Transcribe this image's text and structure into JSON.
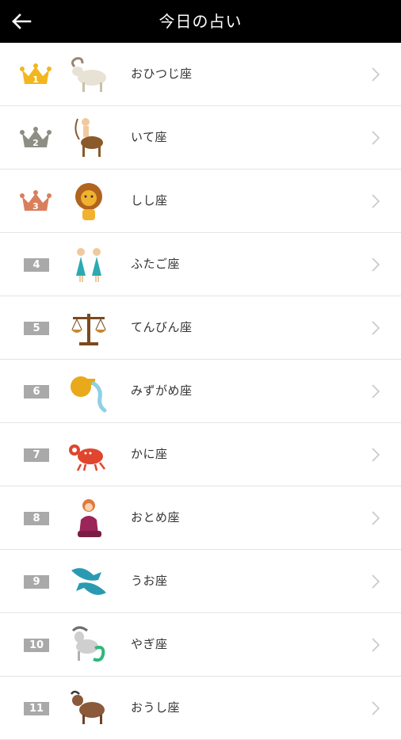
{
  "header": {
    "title": "今日の占い",
    "back_icon": "back-arrow-icon"
  },
  "colors": {
    "gold": "#F2B71E",
    "silver": "#8E8E85",
    "bronze": "#D97F5D",
    "badge": "#A9A9A9"
  },
  "rankings": [
    {
      "rank": "1",
      "sign": "おひつじ座",
      "icon": "aries-ram-icon"
    },
    {
      "rank": "2",
      "sign": "いて座",
      "icon": "sagittarius-centaur-icon"
    },
    {
      "rank": "3",
      "sign": "しし座",
      "icon": "leo-lion-icon"
    },
    {
      "rank": "4",
      "sign": "ふたご座",
      "icon": "gemini-twins-icon"
    },
    {
      "rank": "5",
      "sign": "てんびん座",
      "icon": "libra-scales-icon"
    },
    {
      "rank": "6",
      "sign": "みずがめ座",
      "icon": "aquarius-pot-icon"
    },
    {
      "rank": "7",
      "sign": "かに座",
      "icon": "cancer-crab-icon"
    },
    {
      "rank": "8",
      "sign": "おとめ座",
      "icon": "virgo-maiden-icon"
    },
    {
      "rank": "9",
      "sign": "うお座",
      "icon": "pisces-fish-icon"
    },
    {
      "rank": "10",
      "sign": "やぎ座",
      "icon": "capricorn-goat-icon"
    },
    {
      "rank": "11",
      "sign": "おうし座",
      "icon": "taurus-bull-icon"
    }
  ]
}
